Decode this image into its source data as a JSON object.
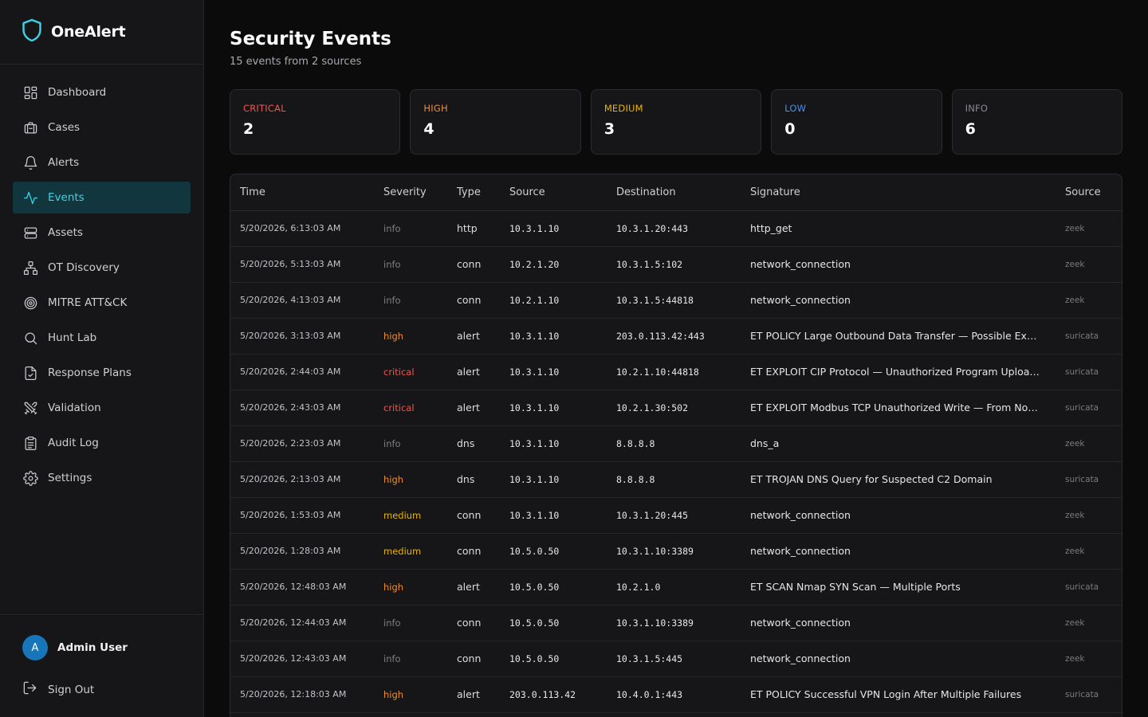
{
  "app": {
    "name": "OneAlert"
  },
  "sidebar": {
    "items": [
      {
        "label": "Dashboard",
        "icon": "dashboard-icon",
        "active": false
      },
      {
        "label": "Cases",
        "icon": "briefcase-icon",
        "active": false
      },
      {
        "label": "Alerts",
        "icon": "bell-icon",
        "active": false
      },
      {
        "label": "Events",
        "icon": "activity-icon",
        "active": true
      },
      {
        "label": "Assets",
        "icon": "server-icon",
        "active": false
      },
      {
        "label": "OT Discovery",
        "icon": "network-icon",
        "active": false
      },
      {
        "label": "MITRE ATT&CK",
        "icon": "target-icon",
        "active": false
      },
      {
        "label": "Hunt Lab",
        "icon": "search-icon",
        "active": false
      },
      {
        "label": "Response Plans",
        "icon": "file-check-icon",
        "active": false
      },
      {
        "label": "Validation",
        "icon": "swords-icon",
        "active": false
      },
      {
        "label": "Audit Log",
        "icon": "clipboard-icon",
        "active": false
      },
      {
        "label": "Settings",
        "icon": "gear-icon",
        "active": false
      }
    ],
    "user": {
      "initial": "A",
      "name": "Admin User"
    },
    "sign_out": "Sign Out"
  },
  "header": {
    "title": "Security Events",
    "subtitle": "15 events from 2 sources"
  },
  "summary": [
    {
      "label": "CRITICAL",
      "value": "2",
      "color": "#f0564d"
    },
    {
      "label": "HIGH",
      "value": "4",
      "color": "#f28b2b"
    },
    {
      "label": "MEDIUM",
      "value": "3",
      "color": "#eab308"
    },
    {
      "label": "LOW",
      "value": "0",
      "color": "#4a8ff0"
    },
    {
      "label": "INFO",
      "value": "6",
      "color": "#8a8a90"
    }
  ],
  "severity_colors": {
    "info": "#7e7e84",
    "high": "#f28b2b",
    "critical": "#f0564d",
    "medium": "#eab308"
  },
  "table": {
    "columns": [
      "Time",
      "Severity",
      "Type",
      "Source",
      "Destination",
      "Signature",
      "Source"
    ],
    "rows": [
      {
        "time": "5/20/2026, 6:13:03 AM",
        "severity": "info",
        "type": "http",
        "src": "10.3.1.10",
        "dst": "10.3.1.20:443",
        "signature": "http_get",
        "engine": "zeek"
      },
      {
        "time": "5/20/2026, 5:13:03 AM",
        "severity": "info",
        "type": "conn",
        "src": "10.2.1.20",
        "dst": "10.3.1.5:102",
        "signature": "network_connection",
        "engine": "zeek"
      },
      {
        "time": "5/20/2026, 4:13:03 AM",
        "severity": "info",
        "type": "conn",
        "src": "10.2.1.10",
        "dst": "10.3.1.5:44818",
        "signature": "network_connection",
        "engine": "zeek"
      },
      {
        "time": "5/20/2026, 3:13:03 AM",
        "severity": "high",
        "type": "alert",
        "src": "10.3.1.10",
        "dst": "203.0.113.42:443",
        "signature": "ET POLICY Large Outbound Data Transfer — Possible Exfilt...",
        "engine": "suricata"
      },
      {
        "time": "5/20/2026, 2:44:03 AM",
        "severity": "critical",
        "type": "alert",
        "src": "10.3.1.10",
        "dst": "10.2.1.10:44818",
        "signature": "ET EXPLOIT CIP Protocol — Unauthorized Program Upload...",
        "engine": "suricata"
      },
      {
        "time": "5/20/2026, 2:43:03 AM",
        "severity": "critical",
        "type": "alert",
        "src": "10.3.1.10",
        "dst": "10.2.1.30:502",
        "signature": "ET EXPLOIT Modbus TCP Unauthorized Write — From Non...",
        "engine": "suricata"
      },
      {
        "time": "5/20/2026, 2:23:03 AM",
        "severity": "info",
        "type": "dns",
        "src": "10.3.1.10",
        "dst": "8.8.8.8",
        "signature": "dns_a",
        "engine": "zeek"
      },
      {
        "time": "5/20/2026, 2:13:03 AM",
        "severity": "high",
        "type": "dns",
        "src": "10.3.1.10",
        "dst": "8.8.8.8",
        "signature": "ET TROJAN DNS Query for Suspected C2 Domain",
        "engine": "suricata"
      },
      {
        "time": "5/20/2026, 1:53:03 AM",
        "severity": "medium",
        "type": "conn",
        "src": "10.3.1.10",
        "dst": "10.3.1.20:445",
        "signature": "network_connection",
        "engine": "zeek"
      },
      {
        "time": "5/20/2026, 1:28:03 AM",
        "severity": "medium",
        "type": "conn",
        "src": "10.5.0.50",
        "dst": "10.3.1.10:3389",
        "signature": "network_connection",
        "engine": "zeek"
      },
      {
        "time": "5/20/2026, 12:48:03 AM",
        "severity": "high",
        "type": "alert",
        "src": "10.5.0.50",
        "dst": "10.2.1.0",
        "signature": "ET SCAN Nmap SYN Scan — Multiple Ports",
        "engine": "suricata"
      },
      {
        "time": "5/20/2026, 12:44:03 AM",
        "severity": "info",
        "type": "conn",
        "src": "10.5.0.50",
        "dst": "10.3.1.10:3389",
        "signature": "network_connection",
        "engine": "zeek"
      },
      {
        "time": "5/20/2026, 12:43:03 AM",
        "severity": "info",
        "type": "conn",
        "src": "10.5.0.50",
        "dst": "10.3.1.5:445",
        "signature": "network_connection",
        "engine": "zeek"
      },
      {
        "time": "5/20/2026, 12:18:03 AM",
        "severity": "high",
        "type": "alert",
        "src": "203.0.113.42",
        "dst": "10.4.0.1:443",
        "signature": "ET POLICY Successful VPN Login After Multiple Failures",
        "engine": "suricata"
      }
    ]
  }
}
